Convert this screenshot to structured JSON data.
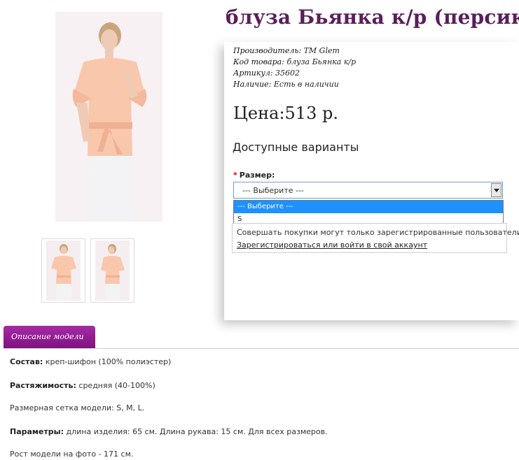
{
  "product": {
    "title": "блуза Бьянка к/р (персик)",
    "meta": [
      {
        "label": "Производитель:",
        "value": "TM Glem"
      },
      {
        "label": "Код товара:",
        "value": "блуза Бьянка к/р"
      },
      {
        "label": "Артикул:",
        "value": "35602"
      },
      {
        "label": "Наличие:",
        "value": "Есть в наличии"
      }
    ],
    "price": "Цена:513 р.",
    "variants_heading": "Доступные варианты"
  },
  "size": {
    "label": "Размер:",
    "selected": "--- Выберите ---",
    "options": [
      "--- Выберите ---",
      "S"
    ]
  },
  "notice": {
    "text": "Совершать покупки могут только зарегистрированные пользователи!",
    "link": "Зарегистрироваться или войти в свой аккаунт"
  },
  "tab": {
    "label": "Описание модели"
  },
  "description": [
    {
      "label": "Состав:",
      "value": "креп-шифон (100% полиэстер)"
    },
    {
      "label": "Растяжимость:",
      "value": "средняя (40-100%)"
    },
    {
      "label": "",
      "value": "Размерная сетка модели: S, M, L."
    },
    {
      "label": "Параметры:",
      "value": "длина изделия: 65 см. Длина рукава: 15 см. Для всех размеров."
    },
    {
      "label": "",
      "value": "Рост модели на фото - 171 см."
    }
  ],
  "colors": {
    "brand": "#7d137d",
    "title": "#5a1e5a",
    "select_highlight": "#1e90ff"
  }
}
